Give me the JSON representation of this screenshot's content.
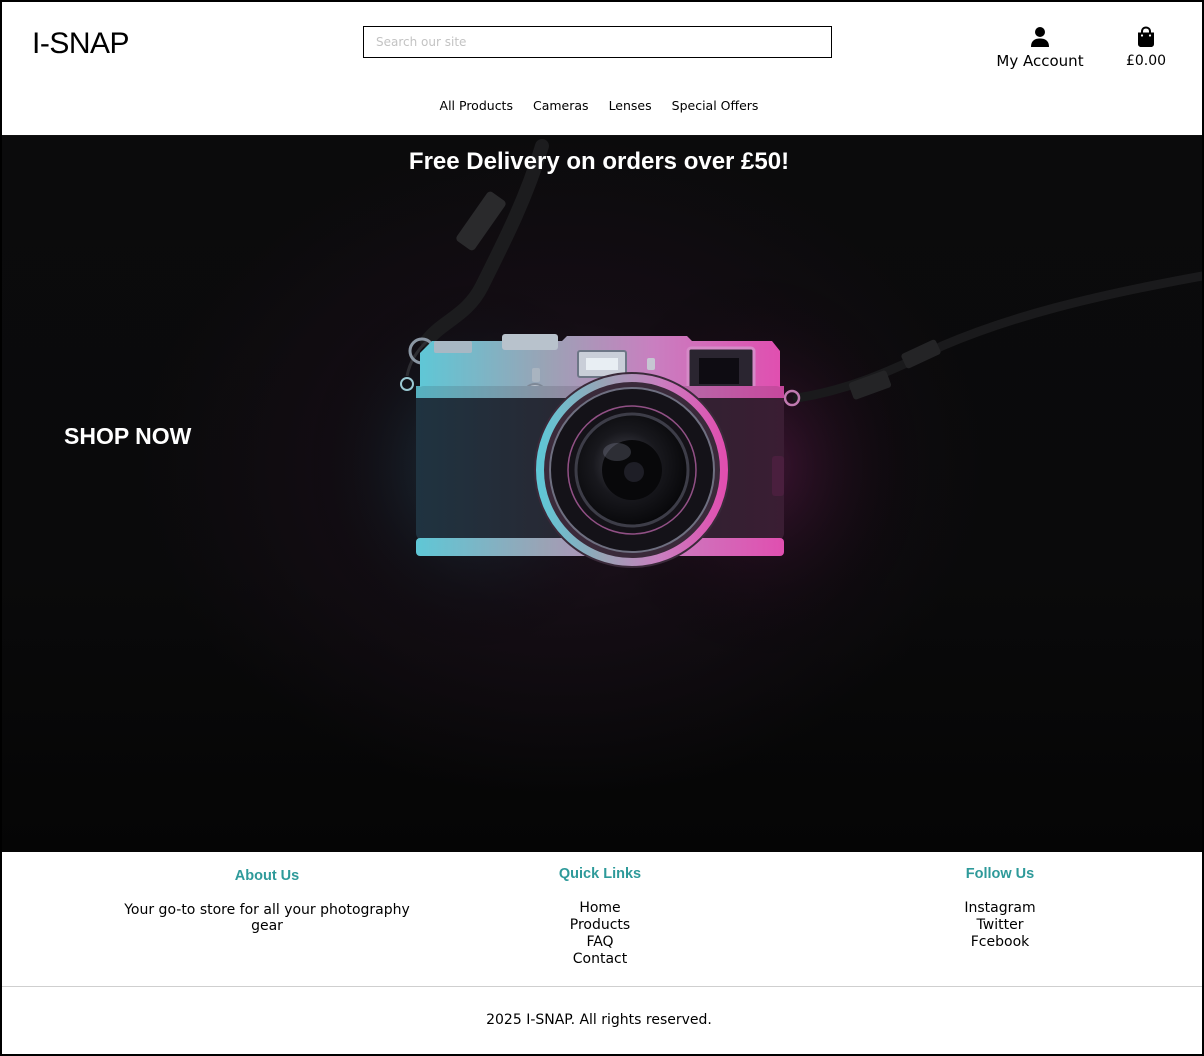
{
  "brand": {
    "logo": "I-SNAP"
  },
  "search": {
    "placeholder": "Search our site",
    "value": ""
  },
  "account": {
    "label": "My Account",
    "icon": "user-icon"
  },
  "cart": {
    "total": "£0.00",
    "icon": "shopping-bag-icon"
  },
  "nav": {
    "items": [
      {
        "label": "All Products"
      },
      {
        "label": "Cameras"
      },
      {
        "label": "Lenses"
      },
      {
        "label": "Special Offers"
      }
    ]
  },
  "hero": {
    "promo": "Free Delivery on orders over £50!",
    "cta": "SHOP NOW",
    "image": "camera-photo"
  },
  "footer": {
    "about": {
      "heading": "About Us",
      "text": "Your go-to store for all your photography gear"
    },
    "quick_links": {
      "heading": "Quick Links",
      "items": [
        "Home",
        "Products",
        "FAQ",
        "Contact"
      ]
    },
    "follow": {
      "heading": "Follow Us",
      "items": [
        "Instagram",
        "Twitter",
        "Fcebook"
      ]
    },
    "copyright": "2025 I-SNAP. All rights reserved."
  },
  "colors": {
    "accent": "#2e9a9a",
    "hero_background": "#0a0a0b",
    "text": "#000000"
  }
}
